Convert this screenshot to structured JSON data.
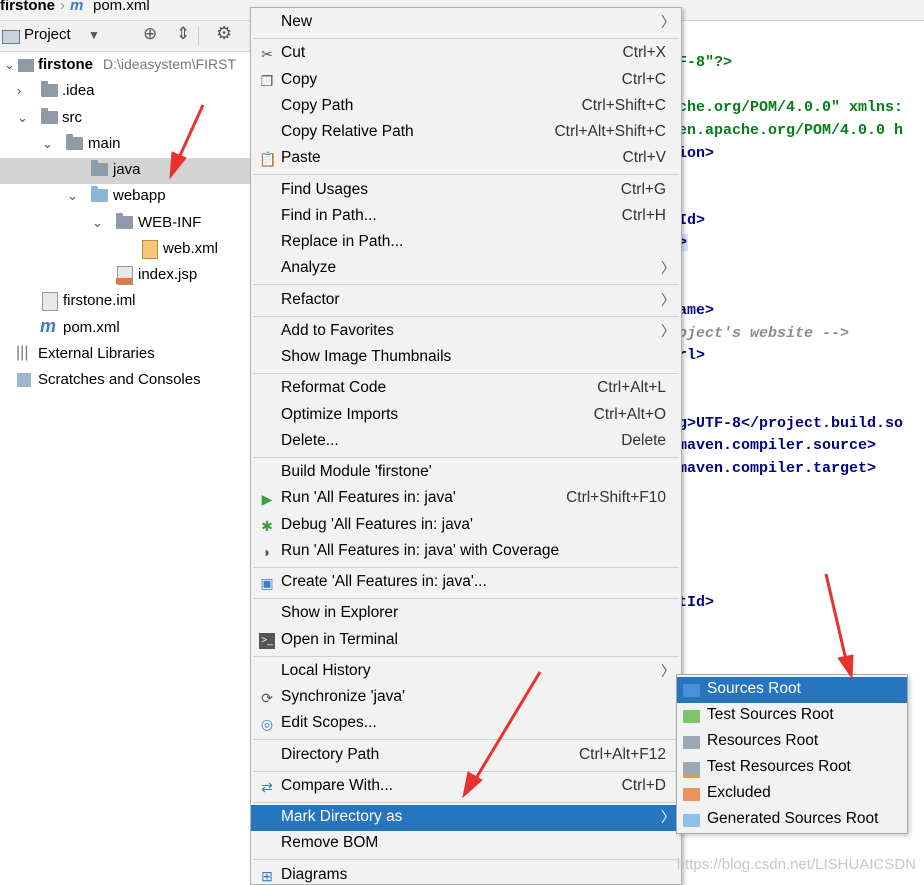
{
  "breadcrumb": {
    "project": "firstone",
    "file": "pom.xml"
  },
  "project_panel": {
    "title": "Project",
    "tree": [
      {
        "label": "firstone",
        "path": "D:\\ideasystem\\FIRST"
      },
      {
        "label": ".idea"
      },
      {
        "label": "src"
      },
      {
        "label": "main"
      },
      {
        "label": "java"
      },
      {
        "label": "webapp"
      },
      {
        "label": "WEB-INF"
      },
      {
        "label": "web.xml"
      },
      {
        "label": "index.jsp"
      },
      {
        "label": "firstone.iml"
      },
      {
        "label": "pom.xml"
      },
      {
        "label": "External Libraries"
      },
      {
        "label": "Scratches and Consoles"
      }
    ]
  },
  "editor": {
    "lines": [
      "F-8\"?>",
      "che.org/POM/4.0.0\" xmlns:",
      "en.apache.org/POM/4.0.0 h",
      "ion>",
      "Id>",
      ">",
      "ame>",
      "oject's website -->",
      "rl>",
      "g>UTF-8</project.build.so",
      "maven.compiler.source>",
      "maven.compiler.target>",
      "tId>"
    ]
  },
  "context_menu": {
    "items": [
      {
        "label": "New",
        "shortcut": ""
      },
      {
        "label": "Cut",
        "shortcut": "Ctrl+X"
      },
      {
        "label": "Copy",
        "shortcut": "Ctrl+C"
      },
      {
        "label": "Copy Path",
        "shortcut": "Ctrl+Shift+C"
      },
      {
        "label": "Copy Relative Path",
        "shortcut": "Ctrl+Alt+Shift+C"
      },
      {
        "label": "Paste",
        "shortcut": "Ctrl+V"
      },
      {
        "label": "Find Usages",
        "shortcut": "Ctrl+G"
      },
      {
        "label": "Find in Path...",
        "shortcut": "Ctrl+H"
      },
      {
        "label": "Replace in Path...",
        "shortcut": ""
      },
      {
        "label": "Analyze",
        "shortcut": ""
      },
      {
        "label": "Refactor",
        "shortcut": ""
      },
      {
        "label": "Add to Favorites",
        "shortcut": ""
      },
      {
        "label": "Show Image Thumbnails",
        "shortcut": ""
      },
      {
        "label": "Reformat Code",
        "shortcut": "Ctrl+Alt+L"
      },
      {
        "label": "Optimize Imports",
        "shortcut": "Ctrl+Alt+O"
      },
      {
        "label": "Delete...",
        "shortcut": "Delete"
      },
      {
        "label": "Build Module 'firstone'",
        "shortcut": ""
      },
      {
        "label": "Run 'All Features in: java'",
        "shortcut": "Ctrl+Shift+F10"
      },
      {
        "label": "Debug 'All Features in: java'",
        "shortcut": ""
      },
      {
        "label": "Run 'All Features in: java' with Coverage",
        "shortcut": ""
      },
      {
        "label": "Create 'All Features in: java'...",
        "shortcut": ""
      },
      {
        "label": "Show in Explorer",
        "shortcut": ""
      },
      {
        "label": "Open in Terminal",
        "shortcut": ""
      },
      {
        "label": "Local History",
        "shortcut": ""
      },
      {
        "label": "Synchronize 'java'",
        "shortcut": ""
      },
      {
        "label": "Edit Scopes...",
        "shortcut": ""
      },
      {
        "label": "Directory Path",
        "shortcut": "Ctrl+Alt+F12"
      },
      {
        "label": "Compare With...",
        "shortcut": "Ctrl+D"
      },
      {
        "label": "Mark Directory as",
        "shortcut": ""
      },
      {
        "label": "Remove BOM",
        "shortcut": ""
      },
      {
        "label": "Diagrams",
        "shortcut": ""
      }
    ]
  },
  "submenu": {
    "items": [
      {
        "label": "Sources Root"
      },
      {
        "label": "Test Sources Root"
      },
      {
        "label": "Resources Root"
      },
      {
        "label": "Test Resources Root"
      },
      {
        "label": "Excluded"
      },
      {
        "label": "Generated Sources Root"
      }
    ]
  },
  "watermark": "https://blog.csdn.net/LISHUAICSDN",
  "colors": {
    "selection": "#2675bf",
    "annotation": "#e8322d"
  }
}
